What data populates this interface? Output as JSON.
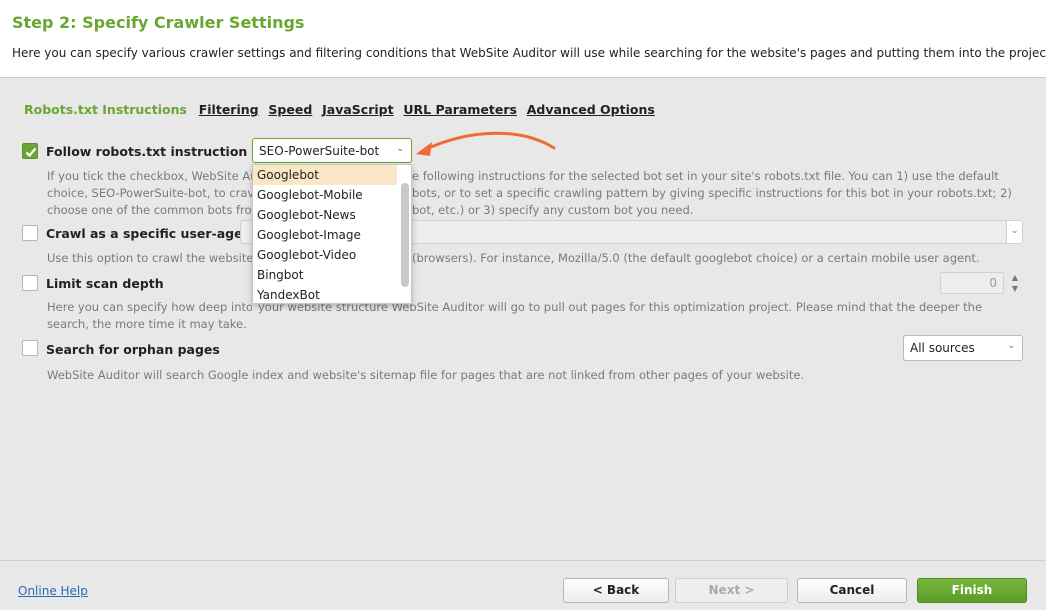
{
  "header": {
    "title": "Step 2: Specify Crawler Settings",
    "description": "Here you can specify various crawler settings and filtering conditions that WebSite Auditor will use while searching for the website's pages and putting them into the project."
  },
  "tabs": [
    {
      "label": "Robots.txt Instructions",
      "active": true
    },
    {
      "label": "Filtering",
      "active": false
    },
    {
      "label": "Speed",
      "active": false
    },
    {
      "label": "JavaScript",
      "active": false
    },
    {
      "label": "URL Parameters",
      "active": false
    },
    {
      "label": "Advanced Options",
      "active": false
    }
  ],
  "options": {
    "robots": {
      "label": "Follow robots.txt instruction for",
      "checked": true,
      "selected": "SEO-PowerSuite-bot",
      "help_lines": [
        "If you tick the checkbox, WebSite Au",
        "choice, SEO-PowerSuite-bot, to crav",
        "choose one of the common bots fro"
      ],
      "help_right_lines": [
        "e following instructions for the selected bot set in your site's robots.txt file. You can 1) use the default",
        "bots, or to set a specific crawling pattern by giving specific instructions for this bot in your robots.txt; 2)",
        "bot, etc.) or 3) specify any custom bot you need."
      ]
    },
    "user_agent": {
      "label": "Crawl as a specific user-agent",
      "checked": false,
      "help_left": "Use this option to crawl the website",
      "help_right": "(browsers). For instance, Mozilla/5.0 (the default googlebot choice) or a certain mobile user agent."
    },
    "scan_depth": {
      "label": "Limit scan depth",
      "checked": false,
      "value": "0",
      "help_line1_left": "Here you can specify how deep into",
      "help_line1_right": "your website structure WebSite Auditor will go to pull out pages for this optimization project. Please mind that the deeper the",
      "help_line2": "search, the more time it may take."
    },
    "orphan": {
      "label": "Search for orphan pages",
      "checked": false,
      "selected": "All sources",
      "help": "WebSite Auditor will search Google index and website's sitemap file for pages that are not linked from other pages of your website."
    }
  },
  "dropdown": {
    "items": [
      "Googlebot",
      "Googlebot-Mobile",
      "Googlebot-News",
      "Googlebot-Image",
      "Googlebot-Video",
      "Bingbot",
      "YandexBot"
    ],
    "highlighted": "Googlebot"
  },
  "footer": {
    "help_link": "Online Help",
    "back": "< Back",
    "next": "Next >",
    "cancel": "Cancel",
    "finish": "Finish"
  },
  "colors": {
    "accent": "#6aa62f",
    "arrow": "#f06a35",
    "highlight": "#fbe6c6"
  }
}
